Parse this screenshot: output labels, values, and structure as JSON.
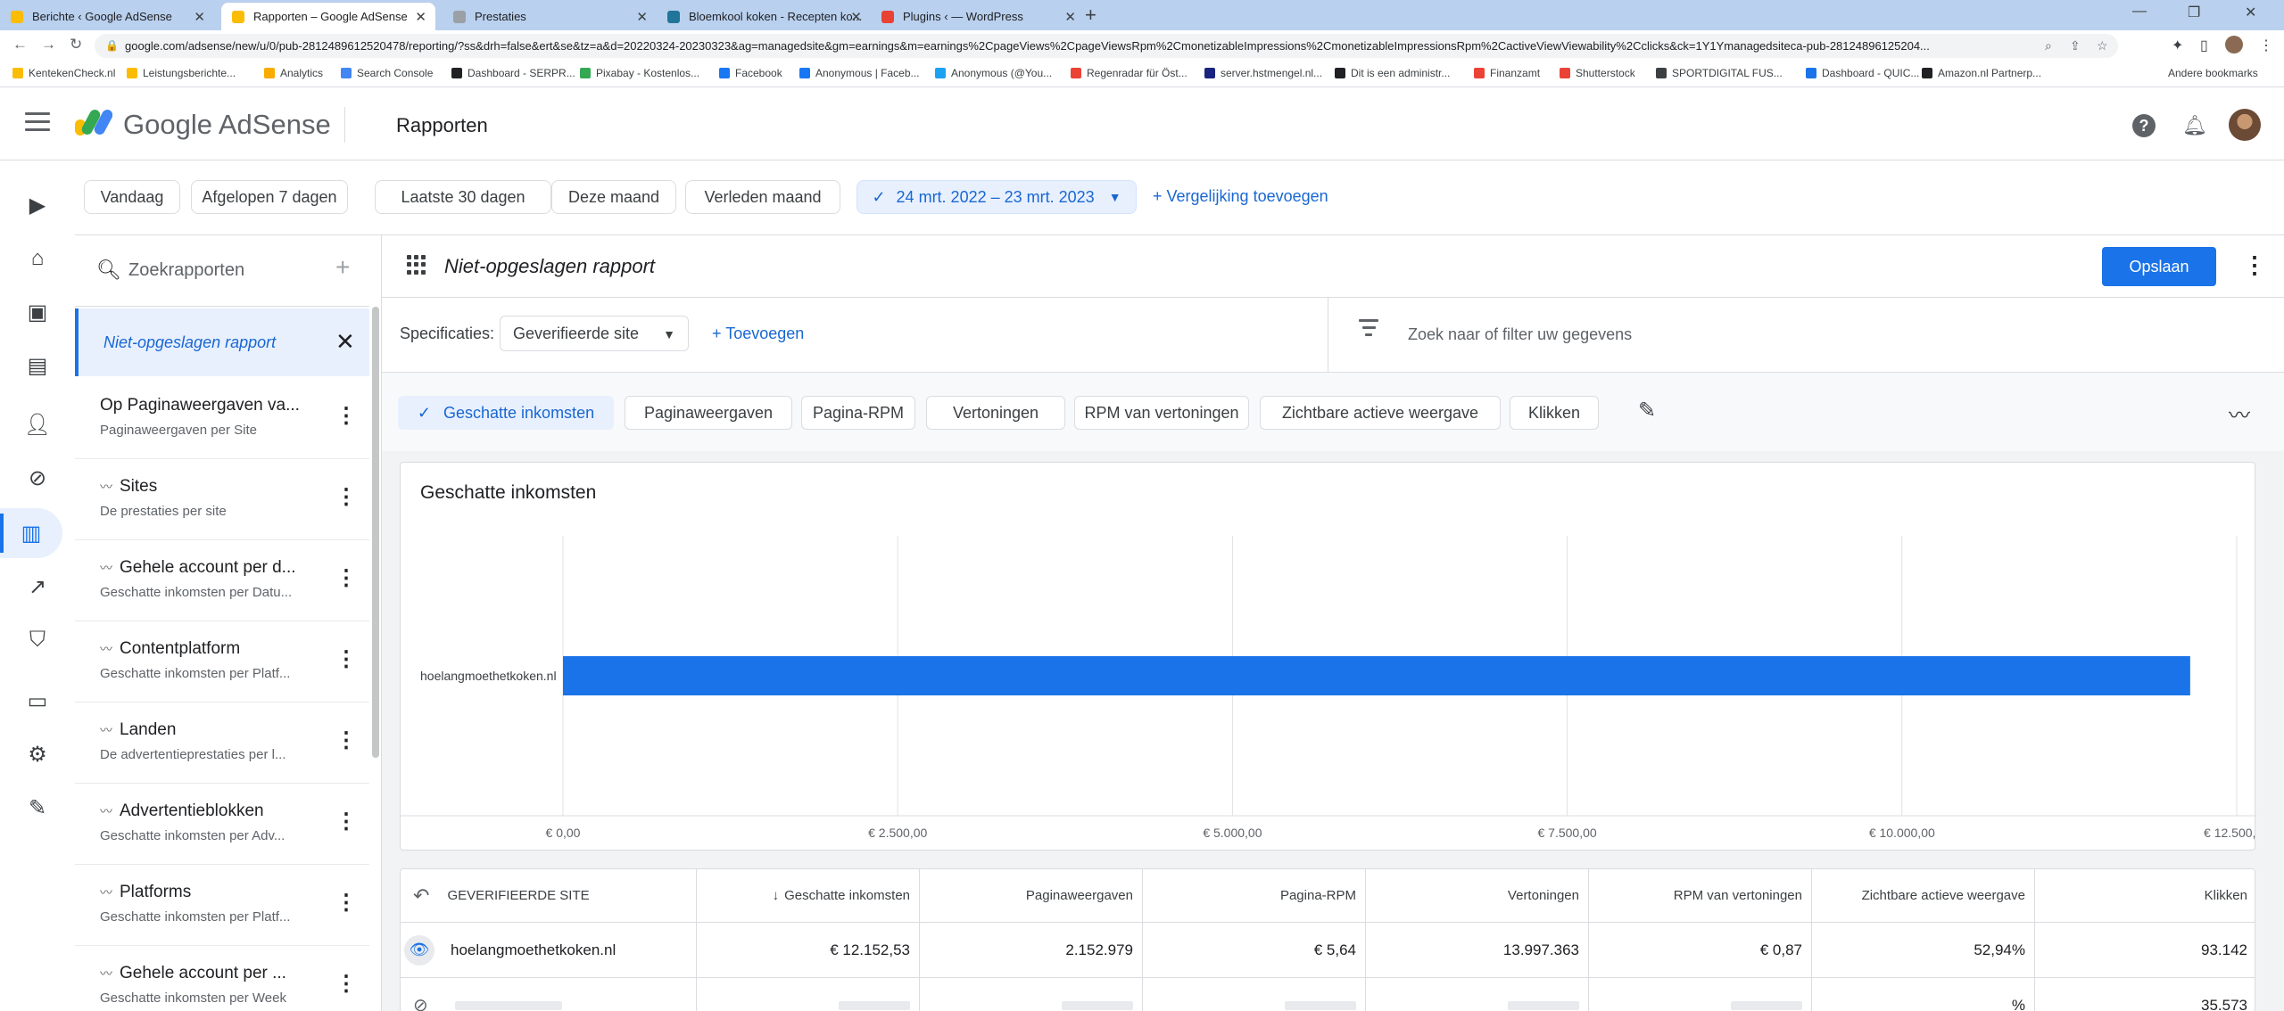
{
  "browser": {
    "tabs": [
      {
        "title": "Berichte ‹ Google AdSense",
        "favicon": "#fbbc04",
        "active": false
      },
      {
        "title": "Rapporten – Google AdSense",
        "favicon": "#fbbc04",
        "active": true
      },
      {
        "title": "Prestaties",
        "favicon": "#9aa0a6",
        "active": false
      },
      {
        "title": "Bloemkool koken - Recepten ko...",
        "favicon": "#21759b",
        "active": false
      },
      {
        "title": "Plugins ‹ — WordPress",
        "favicon": "#e94235",
        "active": false
      }
    ],
    "url": "google.com/adsense/new/u/0/pub-2812489612520478/reporting/?ss&drh=false&ert&se&tz=a&d=20220324-20230323&ag=managedsite&gm=earnings&m=earnings%2CpageViews%2CpageViewsRpm%2CmonetizableImpressions%2CmonetizableImpressionsRpm%2CactiveViewViewability%2Cclicks&ck=1Y1Ymanagedsiteca-pub-28124896125204...",
    "bookmarks": [
      {
        "label": "KentekenCheck.nl",
        "color": "#fbbc04"
      },
      {
        "label": "Leistungsberichte...",
        "color": "#fbbc04"
      },
      {
        "label": "Analytics",
        "color": "#f9ab00"
      },
      {
        "label": "Search Console",
        "color": "#4285f4"
      },
      {
        "label": "Dashboard - SERPR...",
        "color": "#202124"
      },
      {
        "label": "Pixabay - Kostenlos...",
        "color": "#34a853"
      },
      {
        "label": "Facebook",
        "color": "#1877f2"
      },
      {
        "label": "Anonymous | Faceb...",
        "color": "#1877f2"
      },
      {
        "label": "Anonymous (@You...",
        "color": "#1da1f2"
      },
      {
        "label": "Regenradar für Öst...",
        "color": "#ea4335"
      },
      {
        "label": "server.hstmengel.nl...",
        "color": "#1a237e"
      },
      {
        "label": "Dit is een administr...",
        "color": "#202124"
      },
      {
        "label": "Finanzamt",
        "color": "#ea4335"
      },
      {
        "label": "Shutterstock",
        "color": "#ea4335"
      },
      {
        "label": "SPORTDIGITAL FUS...",
        "color": "#3c4043"
      },
      {
        "label": "Dashboard - QUIC...",
        "color": "#1a73e8"
      },
      {
        "label": "Amazon.nl Partnerp...",
        "color": "#202124"
      }
    ],
    "other_bookmarks": "Andere bookmarks"
  },
  "header": {
    "brand": "Google AdSense",
    "title": "Rapporten"
  },
  "date_chips": [
    {
      "label": "Vandaag",
      "selected": false
    },
    {
      "label": "Afgelopen 7 dagen",
      "selected": false
    },
    {
      "label": "Laatste 30 dagen",
      "selected": false
    },
    {
      "label": "Deze maand",
      "selected": false
    },
    {
      "label": "Verleden maand",
      "selected": false
    },
    {
      "label": "24 mrt. 2022 – 23 mrt. 2023",
      "selected": true
    }
  ],
  "compare_link": "Vergelijking toevoegen",
  "sidebar": {
    "search_placeholder": "Zoekrapporten",
    "unsaved": "Niet-opgeslagen rapport",
    "items": [
      {
        "title": "Op Paginaweergaven va...",
        "subtitle": "Paginaweergaven per Site",
        "trend": false
      },
      {
        "title": "Sites",
        "subtitle": "De prestaties per site",
        "trend": true
      },
      {
        "title": "Gehele account per d...",
        "subtitle": "Geschatte inkomsten per Datu...",
        "trend": true
      },
      {
        "title": "Contentplatform",
        "subtitle": "Geschatte inkomsten per Platf...",
        "trend": true
      },
      {
        "title": "Landen",
        "subtitle": "De advertentieprestaties per l...",
        "trend": true
      },
      {
        "title": "Advertentieblokken",
        "subtitle": "Geschatte inkomsten per Adv...",
        "trend": true
      },
      {
        "title": "Platforms",
        "subtitle": "Geschatte inkomsten per Platf...",
        "trend": true
      },
      {
        "title": "Gehele account per ...",
        "subtitle": "Geschatte inkomsten per Week",
        "trend": true
      }
    ]
  },
  "report": {
    "title": "Niet-opgeslagen rapport",
    "save_label": "Opslaan",
    "spec_label": "Specificaties:",
    "spec_value": "Geverifieerde site",
    "add_spec": "Toevoegen",
    "filter_placeholder": "Zoek naar of filter uw gegevens",
    "metrics": [
      {
        "label": "Geschatte inkomsten",
        "selected": true
      },
      {
        "label": "Paginaweergaven",
        "selected": false
      },
      {
        "label": "Pagina-RPM",
        "selected": false
      },
      {
        "label": "Vertoningen",
        "selected": false
      },
      {
        "label": "RPM van vertoningen",
        "selected": false
      },
      {
        "label": "Zichtbare actieve weergave",
        "selected": false
      },
      {
        "label": "Klikken",
        "selected": false
      }
    ]
  },
  "chart_data": {
    "type": "bar",
    "orientation": "horizontal",
    "title": "Geschatte inkomsten",
    "categories": [
      "hoelangmoethetkoken.nl"
    ],
    "values": [
      12152.53
    ],
    "xlim": [
      0,
      12500
    ],
    "x_ticks": [
      0,
      2500,
      5000,
      7500,
      10000,
      12500
    ],
    "x_tick_labels": [
      "€ 0,00",
      "€ 2.500,00",
      "€ 5.000,00",
      "€ 7.500,00",
      "€ 10.000,00",
      "€ 12.500,00"
    ],
    "bar_color": "#1a73e8",
    "grid": true
  },
  "table": {
    "columns": [
      "GEVERIFIEERDE SITE",
      "Geschatte inkomsten",
      "Paginaweergaven",
      "Pagina-RPM",
      "Vertoningen",
      "RPM van vertoningen",
      "Zichtbare actieve weergave",
      "Klikken"
    ],
    "sort_indicator": "↓",
    "rows": [
      {
        "site": "hoelangmoethetkoken.nl",
        "cells": [
          "€ 12.152,53",
          "2.152.979",
          "€ 5,64",
          "13.997.363",
          "€ 0,87",
          "52,94%",
          "93.142"
        ]
      },
      {
        "site": "",
        "cells": [
          "",
          "",
          "",
          "",
          "",
          "%",
          "35.573"
        ]
      }
    ]
  }
}
